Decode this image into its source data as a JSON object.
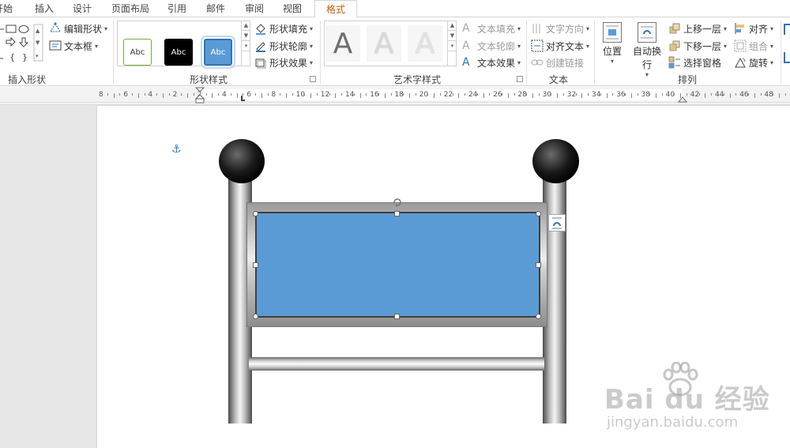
{
  "tabs": [
    {
      "label": "开始",
      "display": "开始"
    },
    {
      "label": "插入"
    },
    {
      "label": "设计"
    },
    {
      "label": "页面布局"
    },
    {
      "label": "引用"
    },
    {
      "label": "邮件"
    },
    {
      "label": "审阅"
    },
    {
      "label": "视图"
    },
    {
      "label": "格式"
    }
  ],
  "ribbon": {
    "insert_shapes": {
      "label": "插入形状",
      "edit_shape": "编辑形状",
      "text_box": "文本框"
    },
    "shape_styles": {
      "label": "形状样式",
      "presets": [
        "Abc",
        "Abc",
        "Abc"
      ],
      "fill": "形状填充",
      "outline": "形状轮廓",
      "effects": "形状效果"
    },
    "wordart_styles": {
      "label": "艺术字样式",
      "letters": [
        "A",
        "A",
        "A"
      ],
      "text_fill": "文本填充",
      "text_outline": "文本轮廓",
      "text_effects": "文本效果"
    },
    "text": {
      "label": "文本",
      "direction": "文字方向",
      "align": "对齐文本",
      "link": "创建链接"
    },
    "arrange": {
      "label": "排列",
      "position": "位置",
      "wrap": "自动换行",
      "bring_forward": "上移一层",
      "send_backward": "下移一层",
      "selection_pane": "选择窗格",
      "align": "对齐",
      "group": "组合",
      "rotate": "旋转"
    }
  },
  "ruler": {
    "labels": [
      "8",
      "6",
      "4",
      "2",
      "2",
      "4",
      "6",
      "8",
      "10",
      "12",
      "14",
      "16",
      "18",
      "20",
      "22",
      "24",
      "26",
      "28",
      "30",
      "32",
      "34",
      "36",
      "38",
      "40",
      "42",
      "44",
      "46",
      "48"
    ]
  },
  "colors": {
    "accent": "#c55a11",
    "shape_fill": "#5b9bd5",
    "anchor": "#2e75b6"
  },
  "watermark": {
    "brand": "Bai du 经验",
    "url": "jingyan.baidu.com"
  }
}
